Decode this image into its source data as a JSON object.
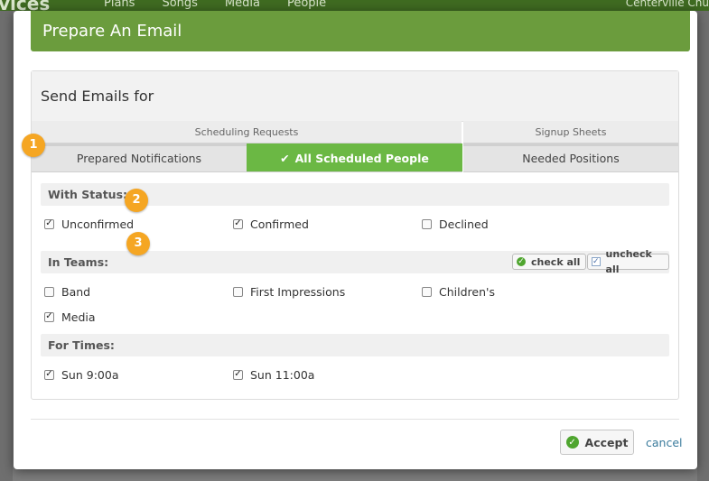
{
  "background": {
    "brand": "vices",
    "nav": [
      "Plans",
      "Songs",
      "Media",
      "People"
    ],
    "user": "Centerville Chu"
  },
  "modal": {
    "title": "Prepare An Email",
    "panel_title": "Send Emails for",
    "groups": {
      "scheduling": "Scheduling Requests",
      "signup": "Signup Sheets"
    },
    "tabs": [
      {
        "label": "Prepared Notifications",
        "active": false
      },
      {
        "label": "All Scheduled People",
        "active": true
      },
      {
        "label": "Needed Positions",
        "active": false
      }
    ],
    "with_status": {
      "label": "With Status:",
      "options": [
        {
          "label": "Unconfirmed",
          "checked": true
        },
        {
          "label": "Confirmed",
          "checked": true
        },
        {
          "label": "Declined",
          "checked": false
        }
      ]
    },
    "in_teams": {
      "label": "In Teams:",
      "check_all": "check all",
      "uncheck_all": "uncheck all",
      "options": [
        {
          "label": "Band",
          "checked": false
        },
        {
          "label": "First Impressions",
          "checked": false
        },
        {
          "label": "Children's",
          "checked": false
        },
        {
          "label": "Media",
          "checked": true
        }
      ]
    },
    "for_times": {
      "label": "For Times:",
      "options": [
        {
          "label": "Sun 9:00a",
          "checked": true
        },
        {
          "label": "Sun 11:00a",
          "checked": true
        }
      ]
    },
    "accept_label": "Accept",
    "cancel_label": "cancel"
  },
  "callouts": [
    "1",
    "2",
    "3"
  ],
  "colors": {
    "header": "#6b9c3d",
    "active_tab": "#6bb844",
    "callout": "#f5a623"
  }
}
